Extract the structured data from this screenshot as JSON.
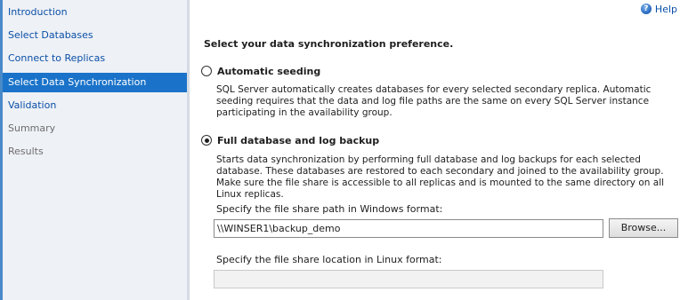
{
  "sidebar": {
    "items": [
      {
        "label": "Introduction"
      },
      {
        "label": "Select Databases"
      },
      {
        "label": "Connect to Replicas"
      },
      {
        "label": "Select Data Synchronization"
      },
      {
        "label": "Validation"
      },
      {
        "label": "Summary"
      },
      {
        "label": "Results"
      }
    ],
    "selected_index": 3
  },
  "help": {
    "label": "Help",
    "icon": "help-icon"
  },
  "main": {
    "title": "Select your data synchronization preference.",
    "options": [
      {
        "label": "Automatic seeding",
        "checked": false,
        "description": "SQL Server automatically creates databases for every selected secondary replica. Automatic seeding requires that the data and log file paths are the same on every SQL Server instance participating in the availability group."
      },
      {
        "label": "Full database and log backup",
        "checked": true,
        "description": "Starts data synchronization by performing full database and log backups for each selected database. These databases are restored to each secondary and joined to the availability group. Make sure the file share is accessible to all replicas and is mounted to the same directory on all Linux replicas."
      }
    ],
    "windows_path_label": "Specify the file share path in Windows format:",
    "windows_path_value": "\\\\WINSER1\\backup_demo",
    "browse_label": "Browse...",
    "linux_path_label": "Specify the file share location in Linux format:",
    "linux_path_value": ""
  },
  "colors": {
    "selected_bg": "#1a73c9",
    "link": "#0a4fa6",
    "sidebar_bg": "#eef1f6"
  }
}
